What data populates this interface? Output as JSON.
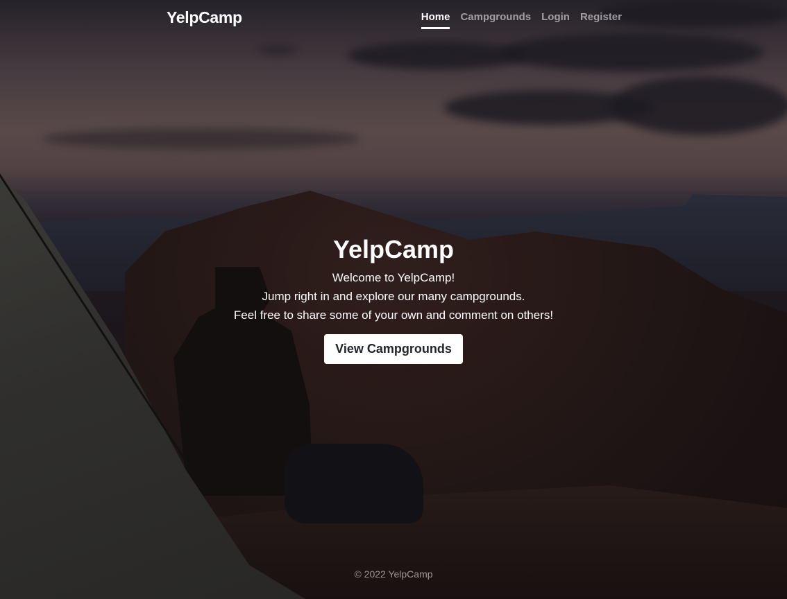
{
  "header": {
    "brand": "YelpCamp",
    "nav": [
      {
        "label": "Home",
        "active": true
      },
      {
        "label": "Campgrounds",
        "active": false
      },
      {
        "label": "Login",
        "active": false
      },
      {
        "label": "Register",
        "active": false
      }
    ]
  },
  "hero": {
    "title": "YelpCamp",
    "lines": [
      "Welcome to YelpCamp!",
      "Jump right in and explore our many campgrounds.",
      "Feel free to share some of your own and comment on others!"
    ],
    "cta_label": "View Campgrounds"
  },
  "footer": {
    "text": "© 2022 YelpCamp"
  },
  "colors": {
    "overlay": "#000000",
    "text": "#ffffff",
    "button_bg": "#ffffff",
    "button_text": "#212529"
  }
}
